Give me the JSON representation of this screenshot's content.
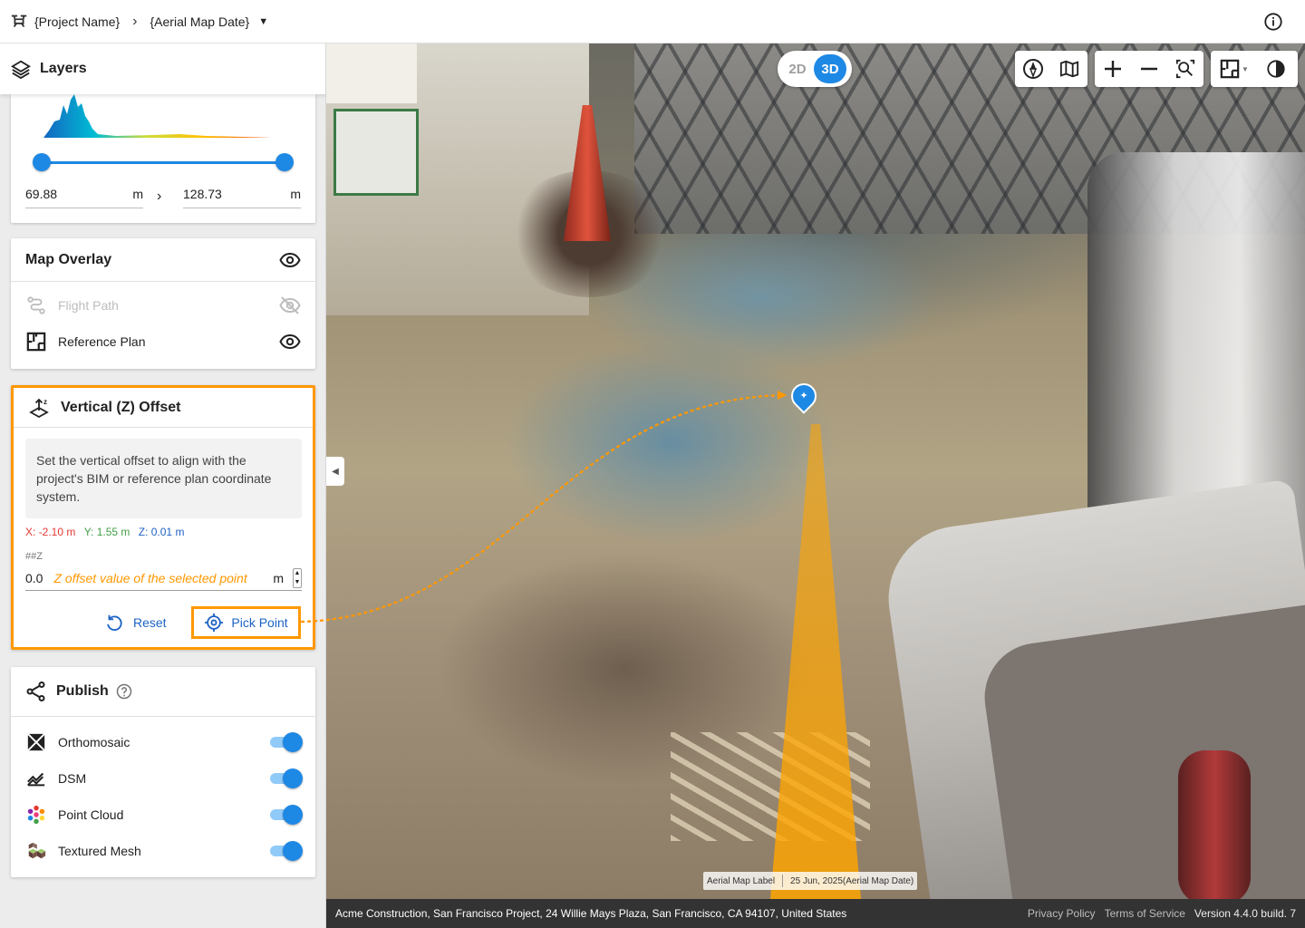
{
  "header": {
    "project_name": "{Project Name}",
    "map_date": "{Aerial Map Date}"
  },
  "sidebar": {
    "title": "Layers",
    "elevation": {
      "min_value": "69.88",
      "max_value": "128.73",
      "unit": "m"
    },
    "map_overlay": {
      "title": "Map Overlay",
      "items": [
        {
          "label": "Flight Path",
          "icon": "flight-path-icon",
          "visible": false,
          "enabled": false
        },
        {
          "label": "Reference Plan",
          "icon": "reference-plan-icon",
          "visible": true,
          "enabled": true
        }
      ]
    },
    "offset": {
      "title": "Vertical (Z) Offset",
      "description": "Set the vertical offset to align with the project's BIM or reference plan coordinate system.",
      "x": "X: -2.10 m",
      "y": "Y: 1.55 m",
      "z": "Z: 0.01 m",
      "field_label": "##Z",
      "value": "0.0",
      "placeholder": "Z offset value of the selected point",
      "unit": "m",
      "reset_label": "Reset",
      "pick_label": "Pick Point"
    },
    "publish": {
      "title": "Publish",
      "items": [
        {
          "label": "Orthomosaic",
          "icon": "orthomosaic-icon",
          "on": true
        },
        {
          "label": "DSM",
          "icon": "dsm-icon",
          "on": true
        },
        {
          "label": "Point Cloud",
          "icon": "point-cloud-icon",
          "on": true
        },
        {
          "label": "Textured Mesh",
          "icon": "textured-mesh-icon",
          "on": true
        }
      ]
    }
  },
  "map": {
    "view_2d": "2D",
    "view_3d": "3D",
    "active_view": "3D",
    "label_name": "Aerial Map Label",
    "label_date": "25 Jun, 2025(Aerial Map Date)"
  },
  "footer": {
    "address": "Acme Construction, San Francisco Project, 24 Willie Mays Plaza, San Francisco, CA 94107, United States",
    "privacy": "Privacy Policy",
    "terms": "Terms of Service",
    "version": "Version 4.4.0 build. 7"
  },
  "colors": {
    "accent": "#1e88e5",
    "highlight": "#ff9800",
    "x_axis": "#e53935",
    "y_axis": "#43a047",
    "z_axis": "#1e63c4"
  }
}
